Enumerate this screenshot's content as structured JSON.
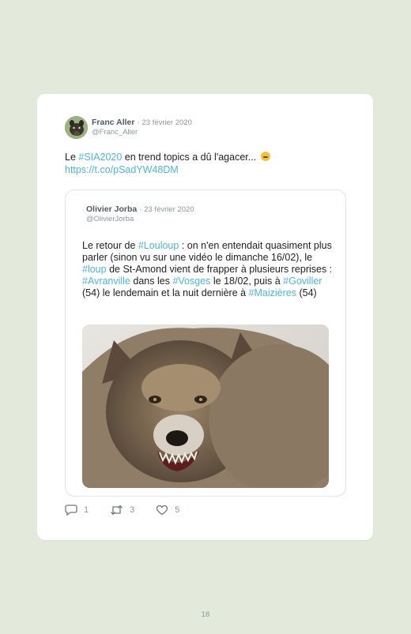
{
  "tweet": {
    "author_name": "Franc Aller",
    "separator": "·",
    "date": "23 février 2020",
    "handle": "@Franc_Aller",
    "text": {
      "line1_pre": "Le ",
      "hashtag": "#SIA2020",
      "line1_post": " en trend topics a dû l'agacer... ",
      "emoji": "thinking-face-emoji",
      "url": "https://t.co/pSadYW48DM"
    },
    "actions": {
      "reply_count": "1",
      "retweet_count": "3",
      "like_count": "5"
    }
  },
  "quoted_tweet": {
    "author_name": "Olivier Jorba",
    "separator": "·",
    "date": "23 février 2020",
    "handle": "@OlivierJorba",
    "text": {
      "p1": "Le retour de ",
      "h1": "#Louloup",
      "p2": " : on n'en entendait quasiment plus parler (sinon vu sur une vidéo le dimanche 16/02), le ",
      "h2": "#loup",
      "p3": " de St-Amond vient de frapper à plusieurs reprises : ",
      "h3": "#Avranville",
      "p4": " dans les ",
      "h4": "#Vosges",
      "p5": " le 18/02, puis à ",
      "h5": "#Goviller",
      "p6": " (54) le lendemain et la nuit dernière à ",
      "h6": "#Maizières",
      "p7": " (54)"
    },
    "image": "snarling-wolf-photo"
  },
  "page_number": "18",
  "colors": {
    "background": "#e3eadb",
    "card": "#ffffff",
    "link": "#4db4e6",
    "muted": "#8e979e"
  }
}
